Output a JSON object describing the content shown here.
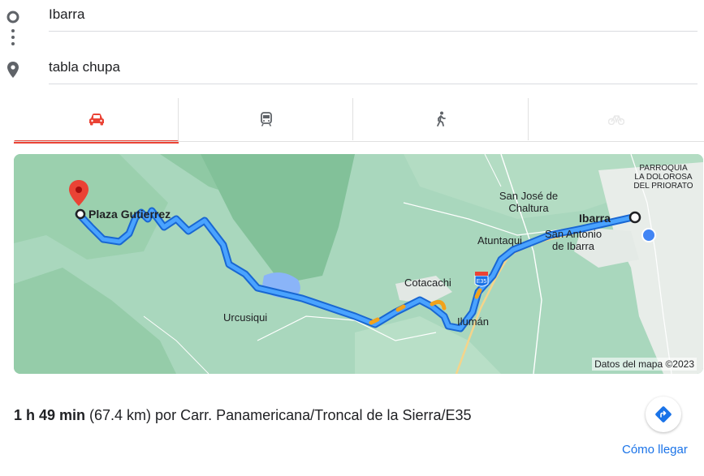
{
  "origin": {
    "value": "Ibarra",
    "icon": "origin-circle-icon"
  },
  "destination": {
    "value": "tabla chupa",
    "icon": "destination-pin-icon"
  },
  "travel_modes": [
    {
      "name": "driving",
      "icon": "car-icon",
      "selected": true
    },
    {
      "name": "transit",
      "icon": "train-icon",
      "selected": false
    },
    {
      "name": "walking",
      "icon": "walking-icon",
      "selected": false
    },
    {
      "name": "cycling",
      "icon": "bicycle-icon",
      "selected": false
    }
  ],
  "colors": {
    "accent_red": "#ea4335",
    "route_blue": "#1a73e8",
    "link_blue": "#1a73e8",
    "traffic_orange": "#f2a21b",
    "map_green": "#a7d6bb"
  },
  "map": {
    "labels": {
      "plaza": "Plaza Gutierrez",
      "parroquia_1": "PARROQUIA",
      "parroquia_2": "LA DOLOROSA",
      "parroquia_3": "DEL PRIORATO",
      "san_jose_1": "San José de",
      "san_jose_2": "Chaltura",
      "ibarra": "Ibarra",
      "atuntaqui": "Atuntaqui",
      "san_antonio_1": "San Antonio",
      "san_antonio_2": "de Ibarra",
      "cotacachi": "Cotacachi",
      "shield": "E35",
      "urcusiqui": "Urcusiqui",
      "iluman": "Ilumán"
    },
    "attribution": "Datos del mapa ©2023"
  },
  "route": {
    "duration": "1 h 49 min",
    "details": " (67.4 km) por Carr. Panamericana/Troncal de la Sierra/E35"
  },
  "directions": {
    "label": "Cómo llegar",
    "icon": "directions-icon"
  }
}
